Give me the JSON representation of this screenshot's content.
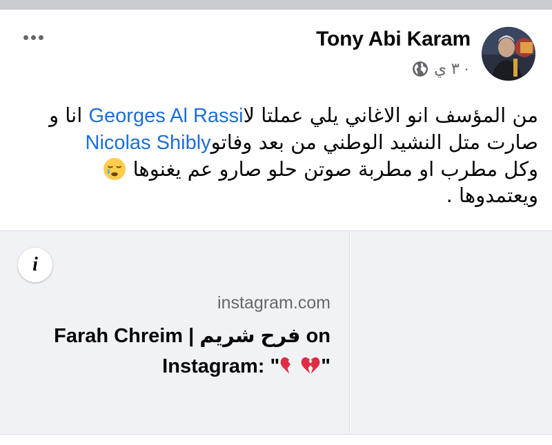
{
  "post": {
    "author": "Tony Abi Karam",
    "timestamp": "٣ ي ·",
    "privacy_icon": "globe-icon",
    "more_icon": "more-options-icon",
    "text": {
      "line1_pre": " انا و ",
      "mention1": "Georges Al Rassi",
      "line1_post": " من المؤسف انو الاغاني يلي عملتا لا",
      "mention2": "Nicolas Shibly",
      "line2_post": "  صارت متل النشيد الوطني من بعد وفاتو",
      "line3": " وكل مطرب او مطربة صوتن حلو صارو عم يغنوها",
      "line4": "ويعتمدوها ."
    },
    "emoji": "sleepy-face-emoji"
  },
  "link_card": {
    "info_label": "i",
    "domain": "instagram.com",
    "title_part1": "Farah Chreim | فرح شريم on",
    "title_part2": "Instagram: \"",
    "title_part3": "\"",
    "heart_icon": "broken-heart-emoji"
  },
  "colors": {
    "mention": "#1c6ed6",
    "card_bg": "#f0f2f5",
    "meta_gray": "#65676b"
  }
}
